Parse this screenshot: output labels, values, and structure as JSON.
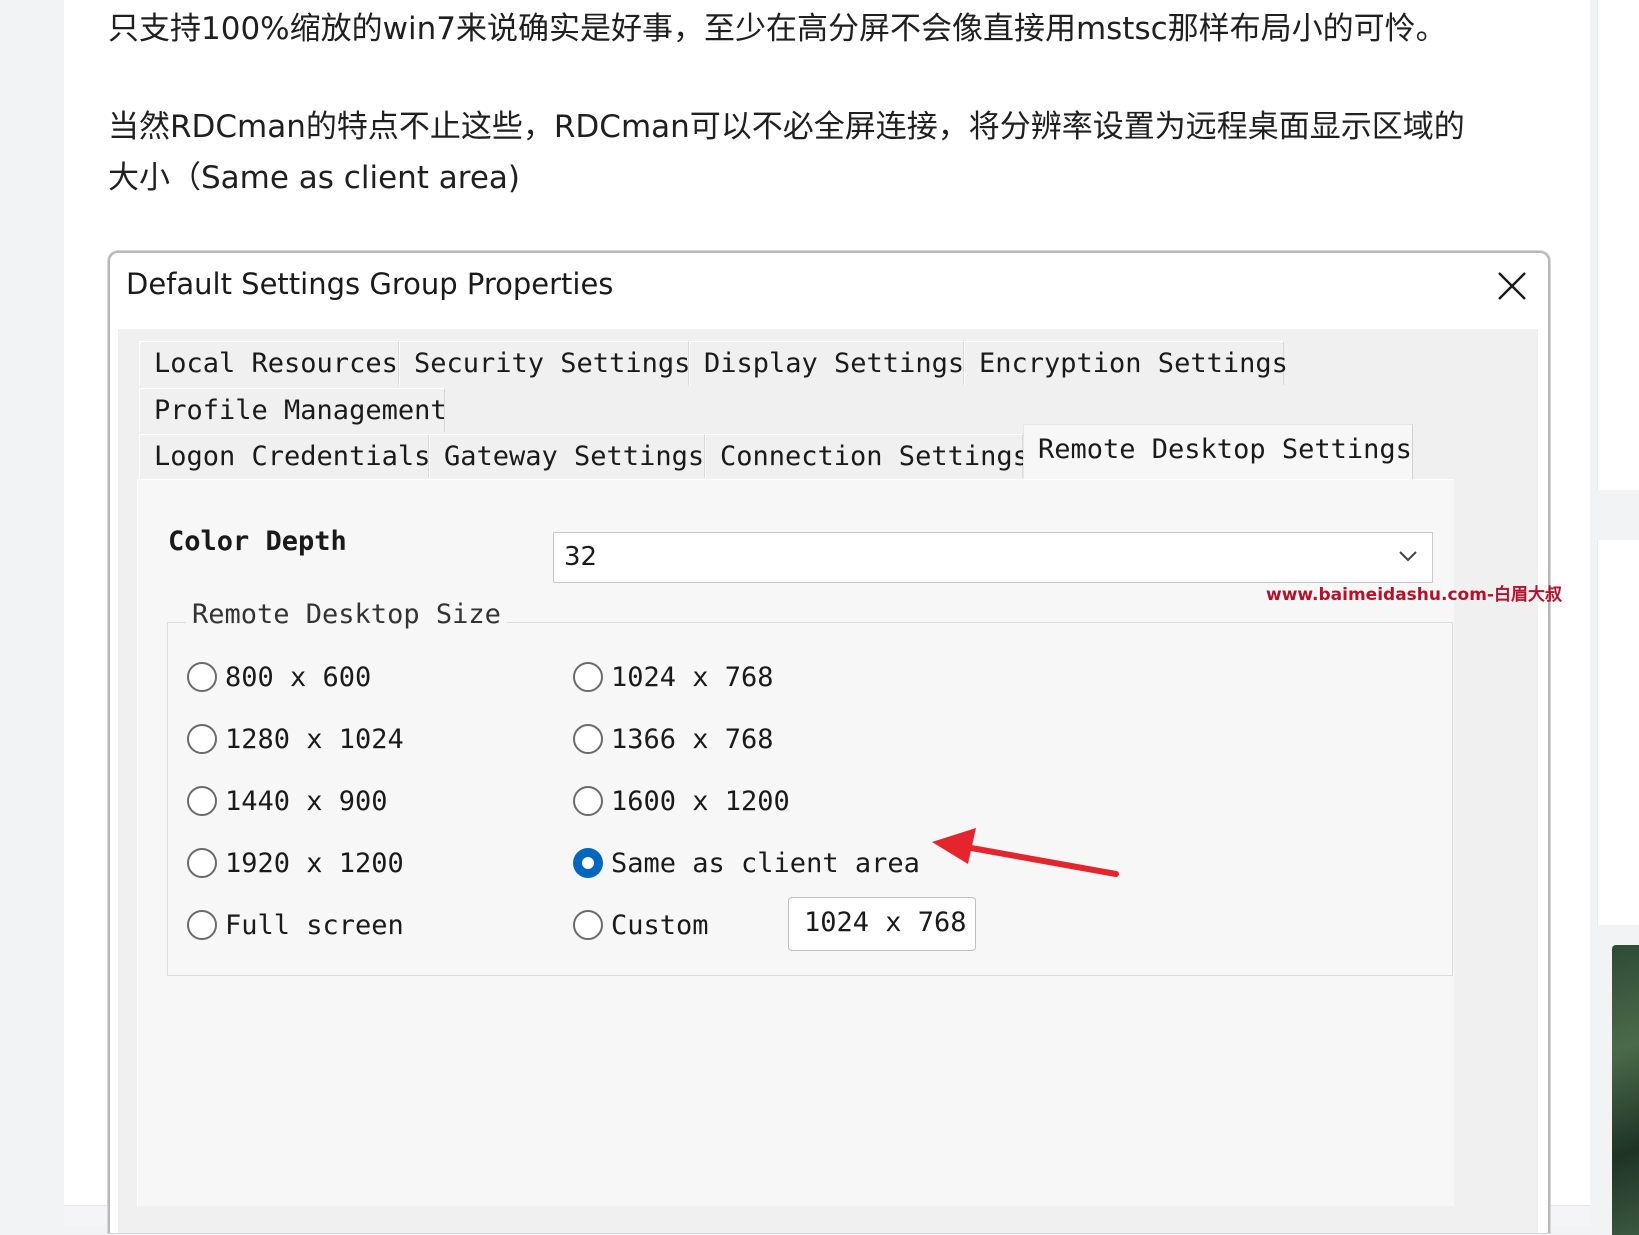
{
  "article": {
    "para1": "只支持100%缩放的win7来说确实是好事，至少在高分屏不会像直接用mstsc那样布局小的可怜。",
    "para2_line1": "当然RDCman的特点不止这些，RDCman可以不必全屏连接，将分辨率设置为远程桌面显示区域的",
    "para2_line2": "大小（Same as client area)"
  },
  "dialog": {
    "title": "Default Settings Group Properties",
    "close_icon": "close-icon",
    "tabs_row1": [
      "Local Resources",
      "Security Settings",
      "Display Settings",
      "Encryption Settings"
    ],
    "tabs_row2": [
      "Profile Management"
    ],
    "tabs_row3": [
      "Logon Credentials",
      "Gateway Settings",
      "Connection Settings",
      "Remote Desktop Settings"
    ],
    "active_tab": "Remote Desktop Settings",
    "color_depth": {
      "label": "Color Depth",
      "value": "32",
      "chevron_icon": "chevron-down-icon"
    },
    "size_group": {
      "legend": "Remote Desktop Size",
      "options": [
        {
          "label": "800 x 600",
          "checked": false
        },
        {
          "label": "1024 x 768",
          "checked": false
        },
        {
          "label": "1280 x 1024",
          "checked": false
        },
        {
          "label": "1366 x 768",
          "checked": false
        },
        {
          "label": "1440 x 900",
          "checked": false
        },
        {
          "label": "1600 x 1200",
          "checked": false
        },
        {
          "label": "1920 x 1200",
          "checked": false
        },
        {
          "label": "Same as client area",
          "checked": true
        },
        {
          "label": "Full screen",
          "checked": false
        },
        {
          "label": "Custom",
          "checked": false
        }
      ],
      "custom_value": "1024 x 768"
    },
    "annotation_arrow": {
      "color": "#e5252d",
      "icon": "red-arrow-icon"
    }
  },
  "watermark": "www.baimeidashu.com-白眉大叔",
  "colors": {
    "radio_checked": "#0067c0",
    "watermark": "#b3122b",
    "arrow": "#e5252d"
  }
}
